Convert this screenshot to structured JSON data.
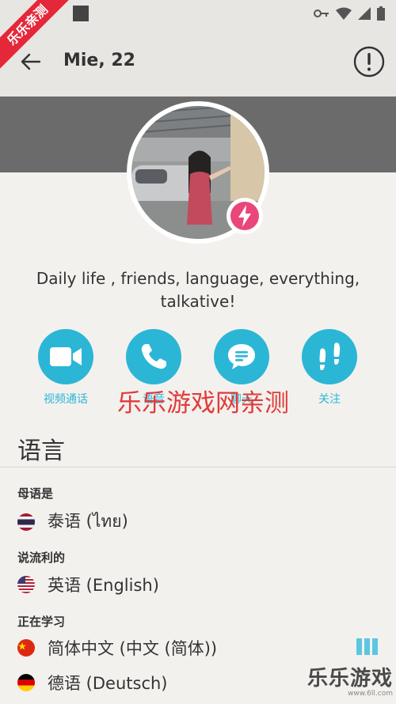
{
  "header": {
    "title": "Mie, 22"
  },
  "profile": {
    "bio": "Daily life , friends, language, everything, talkative!"
  },
  "actions": [
    {
      "label": "视频通话",
      "icon": "video-camera-icon"
    },
    {
      "label": "语音",
      "icon": "phone-icon"
    },
    {
      "label": "聊天",
      "icon": "chat-bubble-icon"
    },
    {
      "label": "关注",
      "icon": "footprints-icon"
    }
  ],
  "languages": {
    "section_title": "语言",
    "native_label": "母语是",
    "native": {
      "name": "泰语 (ไทย)",
      "flag": "thailand-flag"
    },
    "fluent_label": "说流利的",
    "fluent": {
      "name": "英语 (English)",
      "flag": "usa-flag"
    },
    "learning_label": "正在学习",
    "learning": [
      {
        "name": "简体中文 (中文 (简体))",
        "flag": "china-flag",
        "level": "3 of 3"
      },
      {
        "name": "德语 (Deutsch)",
        "flag": "germany-flag"
      }
    ]
  },
  "watermarks": {
    "corner": "乐乐亲测",
    "center": "乐乐游戏网亲测",
    "bottom_big": "乐乐游戏",
    "bottom_small": "www.6ll.com"
  },
  "colors": {
    "accent": "#2bb6d6",
    "badge": "#e9467a",
    "banner": "#6b6b6b",
    "watermark": "#e23a3a"
  }
}
